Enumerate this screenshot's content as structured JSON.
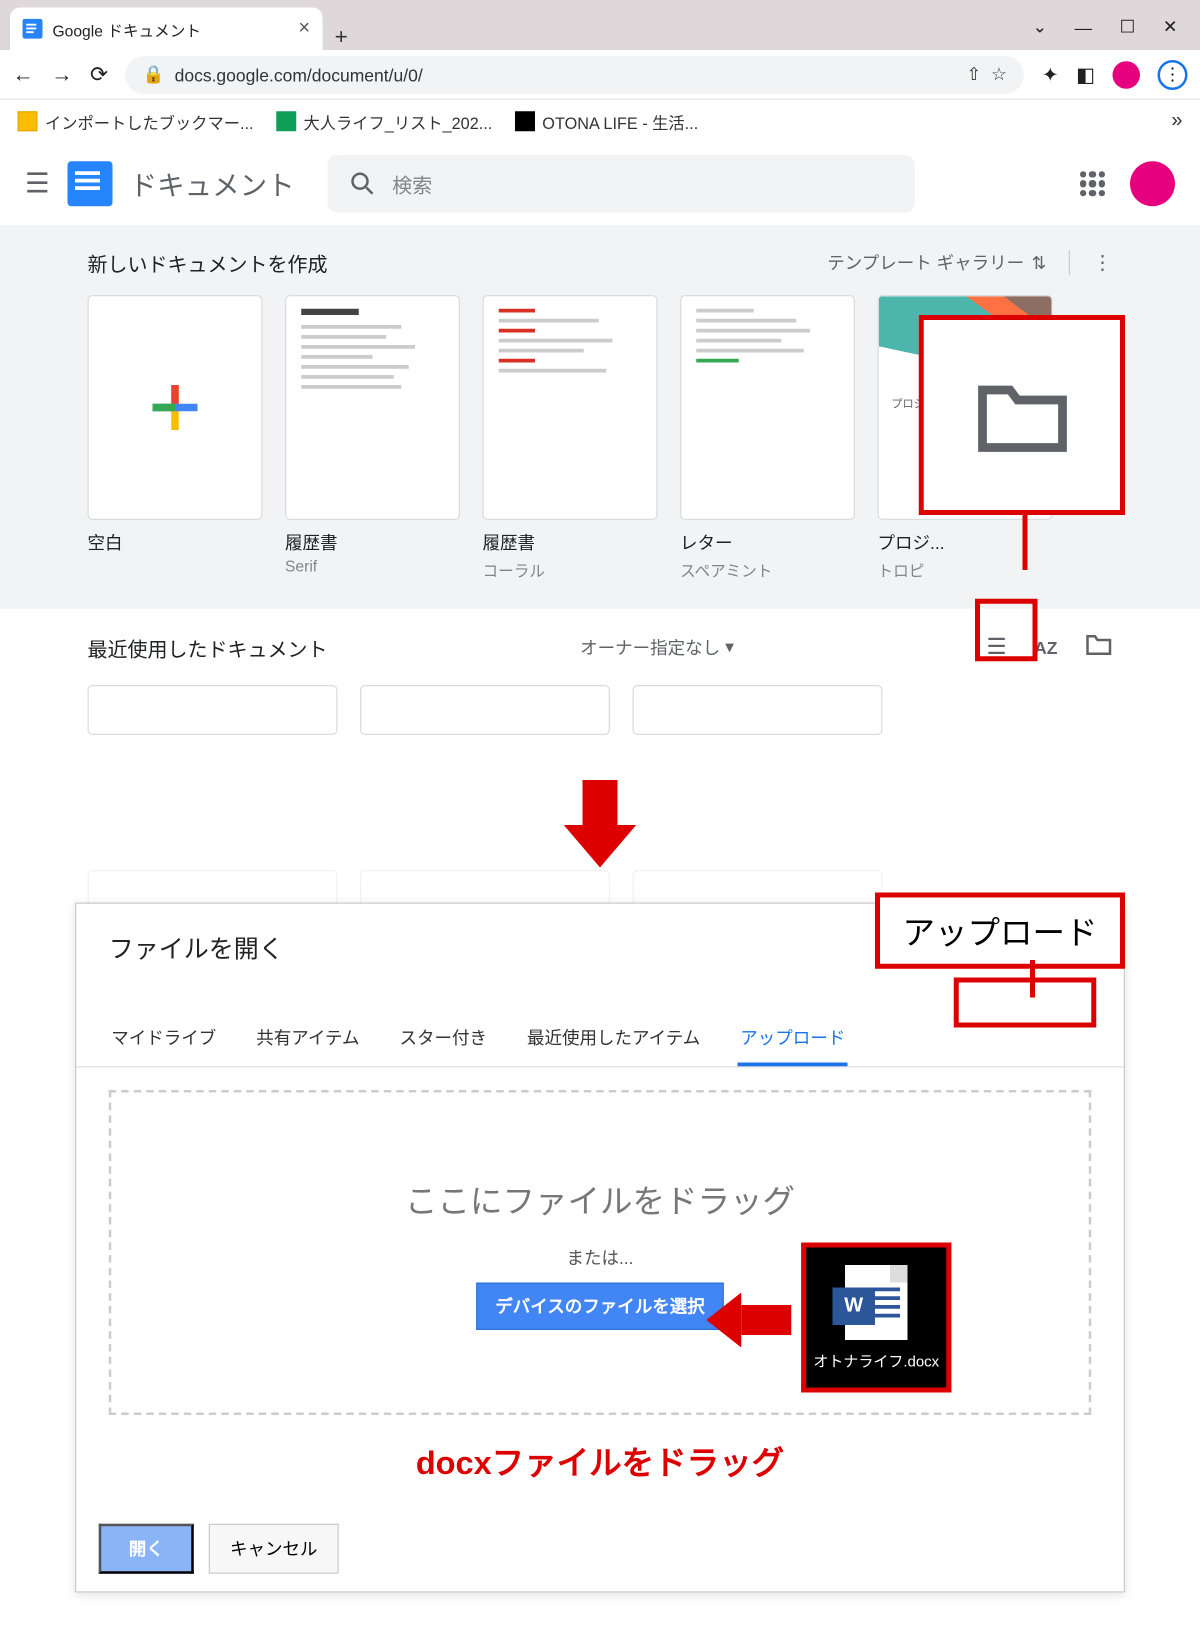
{
  "browser": {
    "tab_title": "Google ドキュメント",
    "url": "docs.google.com/document/u/0/",
    "bookmarks": [
      {
        "label": "インポートしたブックマー...",
        "color": "#fbbc04"
      },
      {
        "label": "大人ライフ_リスト_202...",
        "color": "#0f9d58"
      },
      {
        "label": "OTONA LIFE - 生活...",
        "color": "#000"
      }
    ]
  },
  "docs": {
    "app_name": "ドキュメント",
    "search_placeholder": "検索",
    "template_header": "新しいドキュメントを作成",
    "gallery_label": "テンプレート ギャラリー",
    "templates": [
      {
        "name": "空白",
        "sub": ""
      },
      {
        "name": "履歴書",
        "sub": "Serif"
      },
      {
        "name": "履歴書",
        "sub": "コーラル"
      },
      {
        "name": "レター",
        "sub": "スペアミント"
      },
      {
        "name": "プロジ...",
        "sub": "トロピ"
      }
    ],
    "recent_header": "最近使用したドキュメント",
    "owner_filter": "オーナー指定なし"
  },
  "dialog": {
    "title": "ファイルを開く",
    "tabs": [
      "マイドライブ",
      "共有アイテム",
      "スター付き",
      "最近使用したアイテム",
      "アップロード"
    ],
    "drop_title": "ここにファイルをドラッグ",
    "drop_or": "または...",
    "select_btn": "デバイスのファイルを選択",
    "open_btn": "開く",
    "cancel_btn": "キャンセル"
  },
  "annotations": {
    "upload_callout": "アップロード",
    "drag_file": "オトナライフ.docx",
    "caption": "docxファイルをドラッグ"
  }
}
